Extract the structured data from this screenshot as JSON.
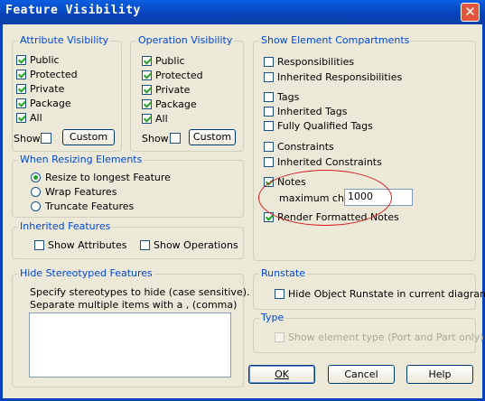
{
  "window": {
    "title": "Feature Visibility",
    "close_glyph": "✕"
  },
  "attribute_visibility": {
    "label": "Attribute Visibility",
    "items": [
      {
        "label": "Public",
        "checked": true
      },
      {
        "label": "Protected",
        "checked": true
      },
      {
        "label": "Private",
        "checked": true
      },
      {
        "label": "Package",
        "checked": true
      },
      {
        "label": "All",
        "checked": true
      }
    ],
    "show_label": "Show",
    "custom_label": "Custom"
  },
  "operation_visibility": {
    "label": "Operation Visibility",
    "items": [
      {
        "label": "Public",
        "checked": true
      },
      {
        "label": "Protected",
        "checked": true
      },
      {
        "label": "Private",
        "checked": true
      },
      {
        "label": "Package",
        "checked": true
      },
      {
        "label": "All",
        "checked": true
      }
    ],
    "show_label": "Show",
    "custom_label": "Custom"
  },
  "resizing": {
    "label": "When Resizing Elements",
    "options": [
      "Resize to longest Feature",
      "Wrap Features",
      "Truncate Features"
    ],
    "selected": "Resize to longest Feature"
  },
  "inherited": {
    "label": "Inherited Features",
    "show_attributes": "Show Attributes",
    "show_operations": "Show Operations"
  },
  "hide_stereotyped": {
    "label": "Hide Stereotyped Features",
    "help_line1": "Specify stereotypes to hide (case sensitive).",
    "help_line2": "Separate multiple items with a , (comma)",
    "value": ""
  },
  "compartments": {
    "label": "Show Element Compartments",
    "responsibilities": "Responsibilities",
    "inherited_responsibilities": "Inherited Responsibilities",
    "tags": "Tags",
    "inherited_tags": "Inherited Tags",
    "fully_qualified_tags": "Fully Qualified Tags",
    "constraints": "Constraints",
    "inherited_constraints": "Inherited Constraints",
    "notes": "Notes",
    "notes_checked": true,
    "max_chars_label": "maximum chars",
    "max_chars_value": "1000",
    "render_formatted_notes": "Render Formatted Notes",
    "render_checked": true
  },
  "runstate": {
    "label": "Runstate",
    "hide_label": "Hide Object Runstate in current diagram"
  },
  "type": {
    "label": "Type",
    "show_label": "Show element type (Port and Part only)"
  },
  "buttons": {
    "ok": "OK",
    "cancel": "Cancel",
    "help": "Help"
  },
  "colors": {
    "titlebar": "#0842b8",
    "group_label": "#0046d5",
    "annotation": "#d81e1e",
    "check": "#21a121"
  }
}
